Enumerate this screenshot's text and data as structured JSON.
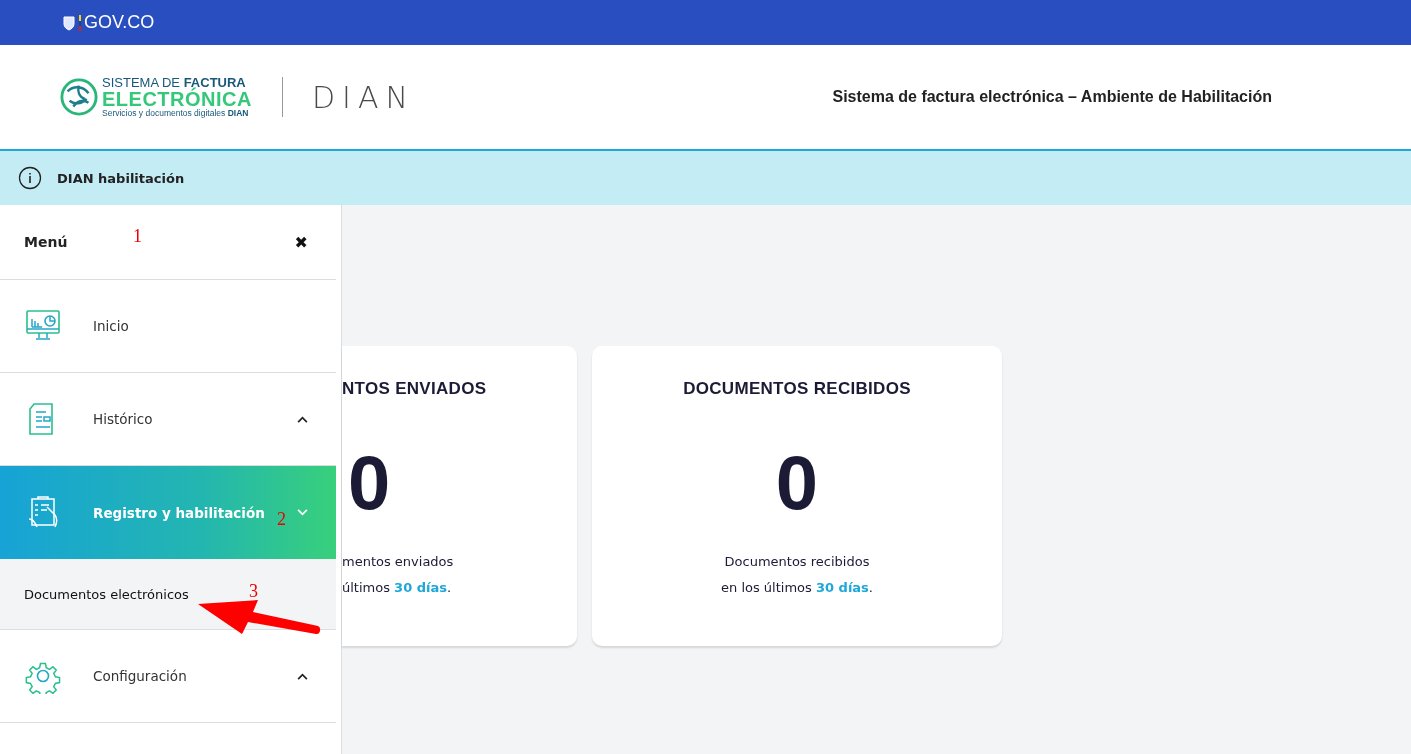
{
  "gov_bar": {
    "brand": "GOV.CO"
  },
  "header": {
    "logo": {
      "line_1": "SISTEMA DE **FACTURA**",
      "line_2": "ELECTRÓNICA",
      "line_3": "Servicios y documentos digitales **DIAN**"
    },
    "agency_logo": "DIAN",
    "title": "Sistema de factura electrónica – Ambiente de Habilitación"
  },
  "info_bar": {
    "text": "DIAN habilitación"
  },
  "sidebar": {
    "title": "Menú",
    "close": "✖",
    "items": [
      {
        "label": "Inicio",
        "kind": "link",
        "selected": false
      },
      {
        "label": "Histórico",
        "kind": "group",
        "selected": false,
        "expanded": false
      },
      {
        "label": "Registro y habilitación",
        "kind": "group",
        "selected": true,
        "expanded": true,
        "children": [
          {
            "label": "Documentos electrónicos",
            "selected": false
          }
        ]
      },
      {
        "label": "Configuración",
        "kind": "group",
        "selected": false,
        "expanded": false
      }
    ]
  },
  "cards": [
    {
      "title": "NTOS ENVIADOS",
      "count": "0",
      "line_1": "mentos enviados",
      "line_2": "últimos **30 días**.",
      "cut": true
    },
    {
      "title": "DOCUMENTOS RECIBIDOS",
      "count": "0",
      "line_1": "Documentos recibidos",
      "line_2": "en los últimos **30 días**.",
      "cut": false
    }
  ],
  "annotations": [
    {
      "text": "1"
    },
    {
      "text": "2"
    },
    {
      "text": "3"
    }
  ]
}
